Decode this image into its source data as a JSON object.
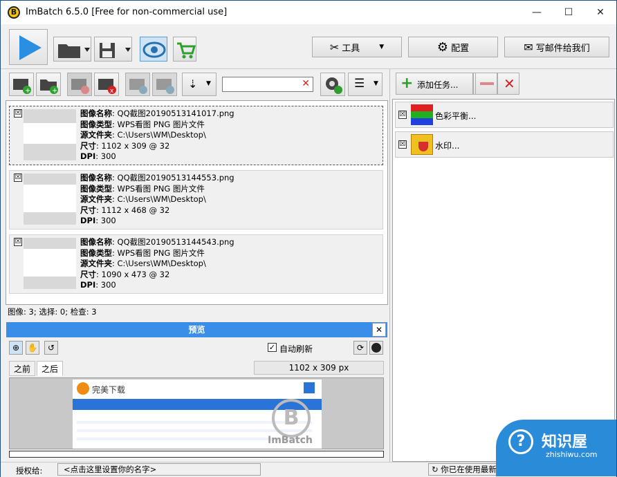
{
  "window": {
    "title": "ImBatch 6.5.0 [Free for non-commercial use]",
    "logo_letter": "B",
    "minimize": "—",
    "maximize": "☐",
    "close": "✕"
  },
  "toolbar": {
    "tools_label": "工具",
    "config_label": "配置",
    "email_label": "写邮件给我们"
  },
  "image_list": {
    "search_value": "",
    "items": [
      {
        "name_label": "图像名称",
        "name": "QQ截图20190513141017.png",
        "type_label": "图像类型",
        "type": "WPS看图 PNG 图片文件",
        "folder_label": "源文件夹",
        "folder": "C:\\Users\\WM\\Desktop\\",
        "size_label": "尺寸",
        "size": "1102 x 309 @ 32",
        "dpi_label": "DPI",
        "dpi": "300",
        "checked": "☒"
      },
      {
        "name_label": "图像名称",
        "name": "QQ截图20190513144553.png",
        "type_label": "图像类型",
        "type": "WPS看图 PNG 图片文件",
        "folder_label": "源文件夹",
        "folder": "C:\\Users\\WM\\Desktop\\",
        "size_label": "尺寸",
        "size": "1112 x 468 @ 32",
        "dpi_label": "DPI",
        "dpi": "300",
        "checked": "☒"
      },
      {
        "name_label": "图像名称",
        "name": "QQ截图20190513144543.png",
        "type_label": "图像类型",
        "type": "WPS看图 PNG 图片文件",
        "folder_label": "源文件夹",
        "folder": "C:\\Users\\WM\\Desktop\\",
        "size_label": "尺寸",
        "size": "1090 x 473 @ 32",
        "dpi_label": "DPI",
        "dpi": "300",
        "checked": "☒"
      }
    ],
    "status": "图像: 3; 选择: 0; 检查: 3"
  },
  "tasks": {
    "add_label": "添加任务...",
    "items": [
      {
        "label": "色彩平衡...",
        "checked": "☒"
      },
      {
        "label": "水印...",
        "checked": "☒"
      }
    ]
  },
  "preview": {
    "title": "预览",
    "auto_refresh": "自动刷新",
    "tab_before": "之前",
    "tab_after": "之后",
    "dimensions": "1102 x 309 px",
    "site_name": "完美下载",
    "watermark": "ImBatch"
  },
  "statusbar": {
    "licensed_label": "授权给:",
    "licensed_value": "<点击这里设置你的名字>",
    "version_text": "你已在使用最新版本"
  },
  "overlay": {
    "brand": "知识屋",
    "url": "zhishiwu.com"
  },
  "colors": {
    "accent": "#3b8ee8",
    "play": "#2a8fe0",
    "remove_red": "#d42020",
    "add_green": "#2e9e2e"
  }
}
